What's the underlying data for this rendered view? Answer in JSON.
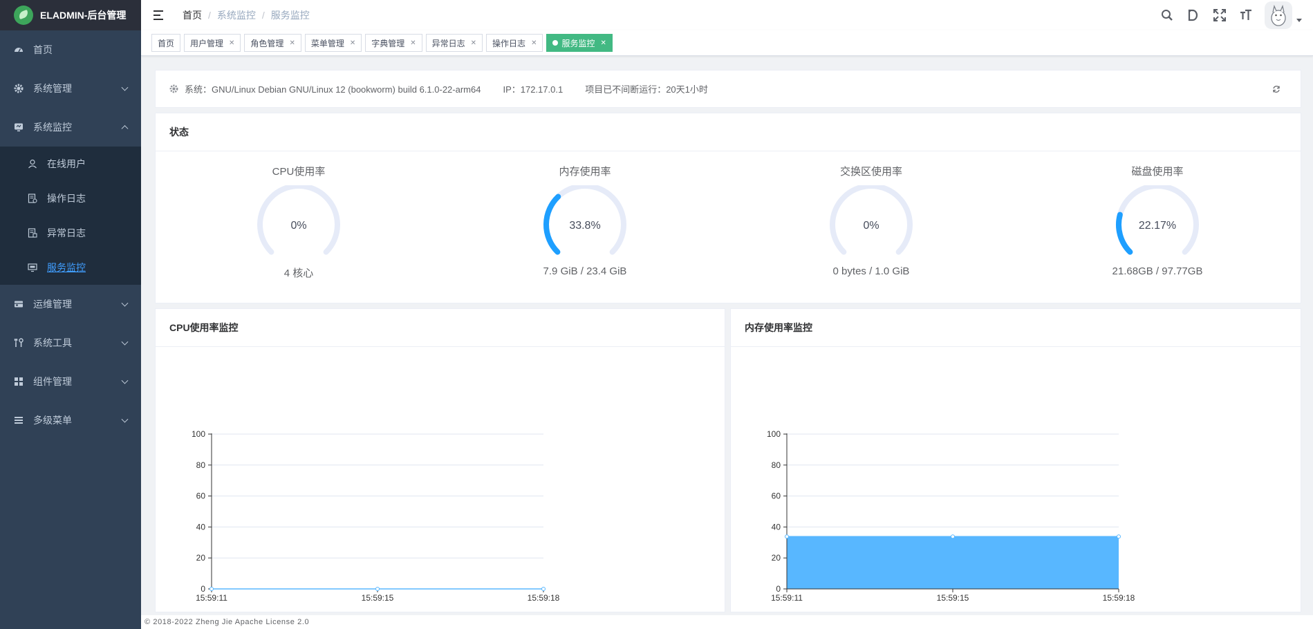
{
  "app": {
    "title": "ELADMIN-后台管理"
  },
  "sidebar": {
    "items": [
      {
        "label": "首页",
        "icon": "dashboard-icon",
        "expanded": false,
        "has_children": false
      },
      {
        "label": "系统管理",
        "icon": "gear-icon",
        "expanded": false,
        "has_children": true
      },
      {
        "label": "系统监控",
        "icon": "monitor-icon",
        "expanded": true,
        "has_children": true
      },
      {
        "label": "运维管理",
        "icon": "server-icon",
        "expanded": false,
        "has_children": true
      },
      {
        "label": "系统工具",
        "icon": "tools-icon",
        "expanded": false,
        "has_children": true
      },
      {
        "label": "组件管理",
        "icon": "grid-icon",
        "expanded": false,
        "has_children": true
      },
      {
        "label": "多级菜单",
        "icon": "list-icon",
        "expanded": false,
        "has_children": true
      }
    ],
    "monitor_children": [
      {
        "label": "在线用户",
        "icon": "user-icon"
      },
      {
        "label": "操作日志",
        "icon": "log-icon"
      },
      {
        "label": "异常日志",
        "icon": "error-log-icon"
      },
      {
        "label": "服务监控",
        "icon": "monitor-screen-icon",
        "active": true
      }
    ]
  },
  "breadcrumb": [
    "首页",
    "系统监控",
    "服务监控"
  ],
  "tags": [
    {
      "label": "首页",
      "closable": false
    },
    {
      "label": "用户管理",
      "closable": true
    },
    {
      "label": "角色管理",
      "closable": true
    },
    {
      "label": "菜单管理",
      "closable": true
    },
    {
      "label": "字典管理",
      "closable": true
    },
    {
      "label": "异常日志",
      "closable": true
    },
    {
      "label": "操作日志",
      "closable": true
    },
    {
      "label": "服务监控",
      "closable": true,
      "active": true
    }
  ],
  "sysinfo": {
    "os": "系统：GNU/Linux Debian GNU/Linux 12 (bookworm) build 6.1.0-22-arm64",
    "ip": "IP：172.17.0.1",
    "uptime": "项目已不间断运行：20天1小时"
  },
  "status": {
    "title": "状态",
    "gauges": [
      {
        "title": "CPU使用率",
        "value_text": "0%",
        "percent": 0,
        "foot": "4 核心"
      },
      {
        "title": "内存使用率",
        "value_text": "33.8%",
        "percent": 33.8,
        "foot": "7.9 GiB / 23.4 GiB"
      },
      {
        "title": "交换区使用率",
        "value_text": "0%",
        "percent": 0,
        "foot": "0 bytes / 1.0 GiB"
      },
      {
        "title": "磁盘使用率",
        "value_text": "22.17%",
        "percent": 22.17,
        "foot": "21.68GB / 97.77GB"
      }
    ]
  },
  "colors": {
    "accent": "#409eff",
    "gauge_track": "#e6ebf8",
    "gauge_fill": "#1e9fff",
    "area_fill": "#58b7ff",
    "tag_active": "#42b983",
    "sidebar_bg": "#304156"
  },
  "chart_data": [
    {
      "type": "line",
      "title": "CPU使用率监控",
      "x": [
        "15:59:11",
        "15:59:15",
        "15:59:18"
      ],
      "series": [
        {
          "values": [
            0,
            0,
            0
          ]
        }
      ],
      "ylim": [
        0,
        100
      ],
      "yticks": [
        0,
        20,
        40,
        60,
        80,
        100
      ],
      "grid": true,
      "area": false
    },
    {
      "type": "area",
      "title": "内存使用率监控",
      "x": [
        "15:59:11",
        "15:59:15",
        "15:59:18"
      ],
      "series": [
        {
          "values": [
            33.8,
            33.8,
            33.8
          ]
        }
      ],
      "ylim": [
        0,
        100
      ],
      "yticks": [
        0,
        20,
        40,
        60,
        80,
        100
      ],
      "grid": true,
      "area": true
    }
  ],
  "footer": {
    "text": "© 2018-2022 Zheng Jie Apache License 2.0"
  }
}
